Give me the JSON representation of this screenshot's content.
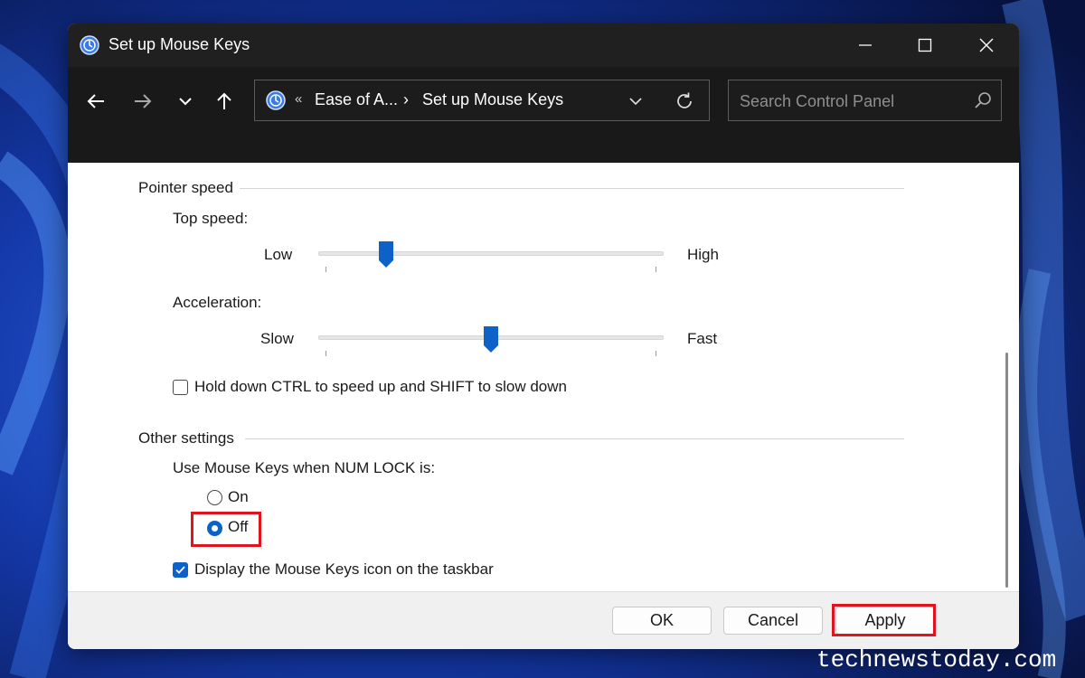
{
  "window": {
    "title": "Set up Mouse Keys"
  },
  "address_bar": {
    "overflow_glyph": "«",
    "crumb_parent": "Ease of A...",
    "separator": "›",
    "crumb_current": "Set up Mouse Keys"
  },
  "search": {
    "placeholder": "Search Control Panel"
  },
  "pointer_speed": {
    "heading": "Pointer speed",
    "top_speed": {
      "label": "Top speed:",
      "min_label": "Low",
      "max_label": "High",
      "value_fraction": 0.18
    },
    "acceleration": {
      "label": "Acceleration:",
      "min_label": "Slow",
      "max_label": "Fast",
      "value_fraction": 0.5
    },
    "ctrl_shift_checkbox": {
      "label": "Hold down CTRL to speed up and SHIFT to slow down",
      "checked": false
    }
  },
  "other_settings": {
    "heading": "Other settings",
    "num_lock_label": "Use Mouse Keys when NUM LOCK is:",
    "options": [
      {
        "label": "On",
        "selected": false
      },
      {
        "label": "Off",
        "selected": true
      }
    ],
    "taskbar_checkbox": {
      "label": "Display the Mouse Keys icon on the taskbar",
      "checked": true
    }
  },
  "footer": {
    "ok_label": "OK",
    "cancel_label": "Cancel",
    "apply_label": "Apply"
  },
  "watermark": "technewstoday.com",
  "colors": {
    "accent": "#0e62c7",
    "highlight": "#e0141e",
    "titlebar": "#202020"
  }
}
